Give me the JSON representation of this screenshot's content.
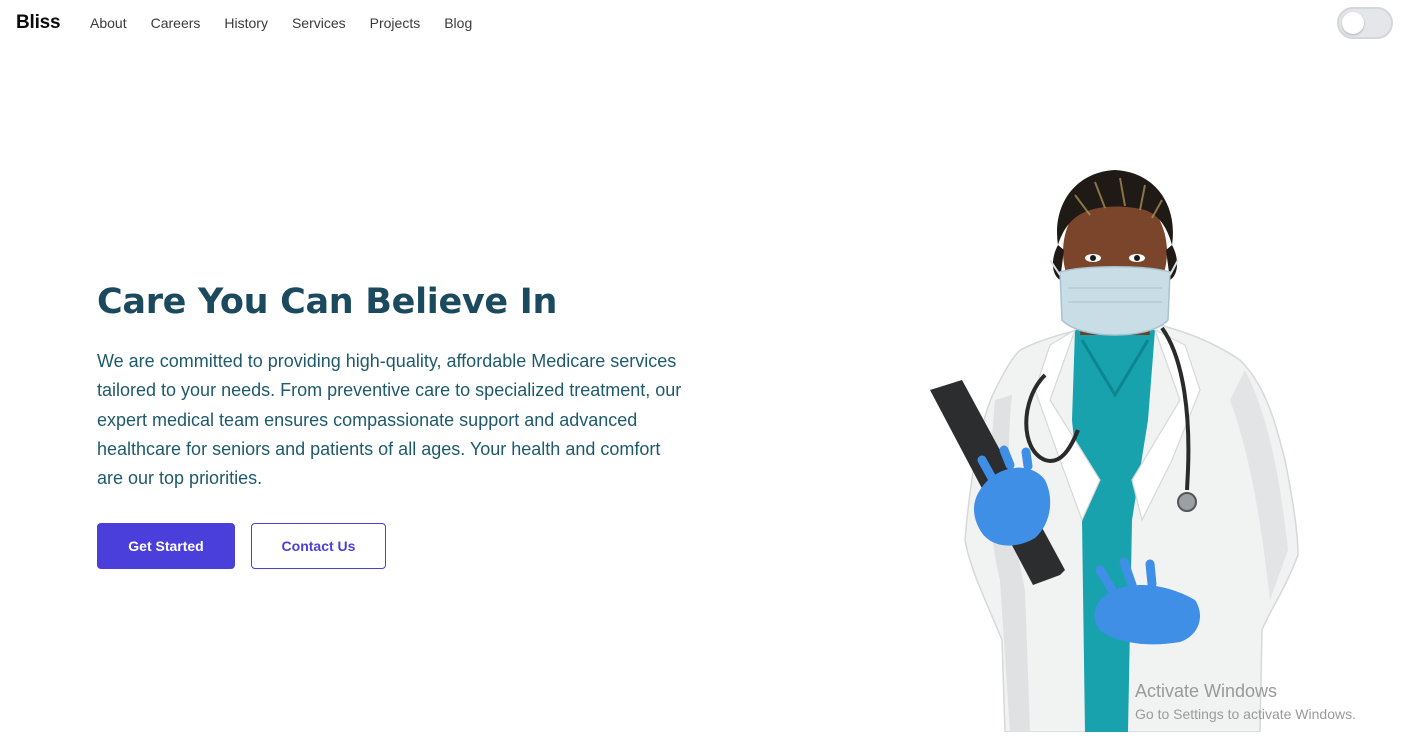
{
  "nav": {
    "brand": "Bliss",
    "links": [
      "About",
      "Careers",
      "History",
      "Services",
      "Projects",
      "Blog"
    ]
  },
  "hero": {
    "title": "Care You Can Believe In",
    "description": "We are committed to providing high-quality, affordable Medicare services tailored to your needs. From preventive care to specialized treatment, our expert medical team ensures compassionate support and advanced healthcare for seniors and patients of all ages. Your health and comfort are our top priorities.",
    "primary_button": "Get Started",
    "secondary_button": "Contact Us"
  },
  "theme_toggle": {
    "state": "off"
  },
  "watermark": {
    "title": "Activate Windows",
    "subtitle": "Go to Settings to activate Windows."
  },
  "colors": {
    "heading": "#1b4a5e",
    "body_text": "#1e5a6c",
    "accent": "#4b3fdb",
    "scrubs": "#17a2ad",
    "gloves": "#3f8fe6"
  },
  "icons": {
    "theme_toggle": "toggle-switch-icon",
    "illustration": "doctor-illustration"
  }
}
